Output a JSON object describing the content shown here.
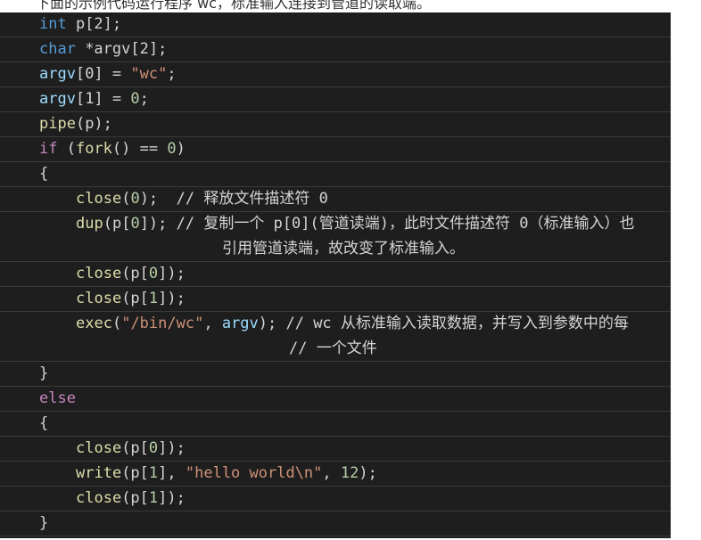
{
  "intro": {
    "text": "下面的示例代码运行程序 wc，标准输入连接到管道的读取端。"
  },
  "code": {
    "line1": {
      "kw": "int",
      "rest": " p[2];"
    },
    "line2": {
      "kw": "char",
      "rest": " *argv[2];"
    },
    "line3": {
      "var": "argv",
      "idx": "[0] = ",
      "str": "\"wc\"",
      "end": ";"
    },
    "line4": {
      "var": "argv",
      "idx": "[1] = ",
      "num": "0",
      "end": ";"
    },
    "line5": {
      "fn": "pipe",
      "rest": "(p);"
    },
    "line6": {
      "kw": "if",
      "open": " (",
      "fn": "fork",
      "mid": "() == ",
      "num": "0",
      "end": ")"
    },
    "line7": {
      "text": "{"
    },
    "line8": {
      "fn": "close",
      "open": "(",
      "num": "0",
      "end": ");  ",
      "cmt": "// 释放文件描述符 0"
    },
    "line9": {
      "fn": "dup",
      "open": "(p[",
      "num": "0",
      "end": "]); ",
      "cmt": "// 复制一个 p[0](管道读端)，此时文件描述符 0（标准输入）也",
      "wrap": "引用管道读端，故改变了标准输入。"
    },
    "line10": {
      "fn": "close",
      "open": "(p[",
      "num": "0",
      "end": "]);"
    },
    "line11": {
      "fn": "close",
      "open": "(p[",
      "num": "1",
      "end": "]);"
    },
    "line12": {
      "fn": "exec",
      "open": "(",
      "str": "\"/bin/wc\"",
      "mid": ", ",
      "var": "argv",
      "end": "); ",
      "cmt": "// wc 从标准输入读取数据，并写入到参数中的每",
      "wrap": "// 一个文件"
    },
    "line13": {
      "text": "}"
    },
    "line14": {
      "kw": "else"
    },
    "line15": {
      "text": "{"
    },
    "line16": {
      "fn": "close",
      "open": "(p[",
      "num": "0",
      "end": "]);"
    },
    "line17": {
      "fn": "write",
      "open": "(p[",
      "num": "1",
      "mid": "], ",
      "str": "\"hello world\\n\"",
      "mid2": ", ",
      "num2": "12",
      "end": ");"
    },
    "line18": {
      "fn": "close",
      "open": "(p[",
      "num": "1",
      "end": "]);"
    },
    "line19": {
      "text": "}"
    }
  }
}
